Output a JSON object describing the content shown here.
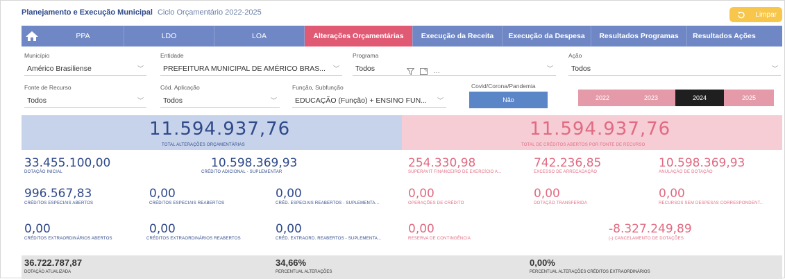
{
  "header": {
    "title": "Planejamento e Execução Municipal",
    "subtitle": "Ciclo Orçamentário 2022-2025",
    "clear_label": "Limpar"
  },
  "nav": {
    "home_icon": "home-icon",
    "items": [
      "PPA",
      "LDO",
      "LOA",
      "Alterações Orçamentárias",
      "Execução da Receita",
      "Execução da Despesa",
      "Resultados Programas",
      "Resultados Ações"
    ],
    "active_index": 3
  },
  "filters": {
    "municipio": {
      "label": "Município",
      "value": "Américo Brasiliense"
    },
    "entidade": {
      "label": "Entidade",
      "value": "PREFEITURA MUNICIPAL DE AMÉRICO BRAS..."
    },
    "programa": {
      "label": "Programa",
      "value": "Todos"
    },
    "acao": {
      "label": "Ação",
      "value": "Todos"
    },
    "fonte": {
      "label": "Fonte de Recurso",
      "value": "Todos"
    },
    "cod_aplicacao": {
      "label": "Cód. Aplicação",
      "value": "Todos"
    },
    "funcao": {
      "label": "Função, Subfunção",
      "value": "EDUCAÇÃO (Função) + ENSINO FUN..."
    },
    "covid": {
      "label": "Covid/Corona/Pandemia",
      "value": "Não"
    },
    "years": [
      "2022",
      "2023",
      "2024",
      "2025"
    ],
    "selected_year": "2024"
  },
  "totals": {
    "left_value": "11.594.937,76",
    "left_label": "TOTAL ALTERAÇÕES ORÇAMENTÁRIAS",
    "right_value": "11.594.937,76",
    "right_label": "TOTAL DE CRÉDITOS ABERTOS POR FONTE DE RECURSO"
  },
  "metrics": {
    "dotacao_inicial": {
      "value": "33.455.100,00",
      "label": "DOTAÇÃO INICIAL"
    },
    "credito_suplementar": {
      "value": "10.598.369,93",
      "label": "CRÉDITO ADICIONAL - SUPLEMENTAR"
    },
    "superavit": {
      "value": "254.330,98",
      "label": "SUPERAVIT FINANCEIRO DE EXERCÍCIO A..."
    },
    "excesso": {
      "value": "742.236,85",
      "label": "EXCESSO DE ARRECADAÇÃO"
    },
    "anulacao": {
      "value": "10.598.369,93",
      "label": "ANULAÇÃO DE DOTAÇÃO"
    },
    "especiais_abertos": {
      "value": "996.567,83",
      "label": "CRÉDITOS ESPECIAIS ABERTOS"
    },
    "especiais_reabertos": {
      "value": "0,00",
      "label": "CRÉDITOS ESPECIAIS REABERTOS"
    },
    "cred_especiais_reab_supl": {
      "value": "0,00",
      "label": "CRÉD. ESPECIAIS REABERTOS - SUPLEMENTA..."
    },
    "operacoes_credito": {
      "value": "0,00",
      "label": "OPERAÇÕES DE CRÉDITO"
    },
    "dotacao_transferida": {
      "value": "0,00",
      "label": "DOTAÇÃO TRANSFERIDA"
    },
    "recursos_sem_despesas": {
      "value": "0,00",
      "label": "RECURSOS SEM DESPESAS CORRESPONDENT..."
    },
    "extra_abertos": {
      "value": "0,00",
      "label": "CRÉDITOS EXTRAORDINÁRIOS ABERTOS"
    },
    "extra_reabertos": {
      "value": "0,00",
      "label": "CRÉDITOS EXTRAORDINÁRIOS REABERTOS"
    },
    "cred_extra_reab_supl": {
      "value": "0,00",
      "label": "CRÉD. EXTRAORD. REABERTOS - SUPLEMENTA..."
    },
    "reserva": {
      "value": "0,00",
      "label": "RESERVA DE CONTINGÊNCIA"
    },
    "cancelamento": {
      "value": "-8.327.249,89",
      "label": "(-) CANCELAMENTO DE DOTAÇÕES"
    }
  },
  "bottom": {
    "dotacao_atualizada": {
      "value": "36.722.787,87",
      "label": "DOTAÇÃO ATUALIZADA"
    },
    "percentual_alteracoes": {
      "value": "34,66%",
      "label": "PERCENTUAL ALTERAÇÕES"
    },
    "percentual_extra": {
      "value": "0,00%",
      "label": "PERCENTUAL ALTERAÇÕES CRÉDITOS EXTRAORDINÁRIOS"
    }
  },
  "colors": {
    "nav": "#6f87c4",
    "active": "#e15a74",
    "blue_text": "#2f4a8a",
    "pink_text": "#e06b82",
    "limpar": "#f7c64a"
  }
}
